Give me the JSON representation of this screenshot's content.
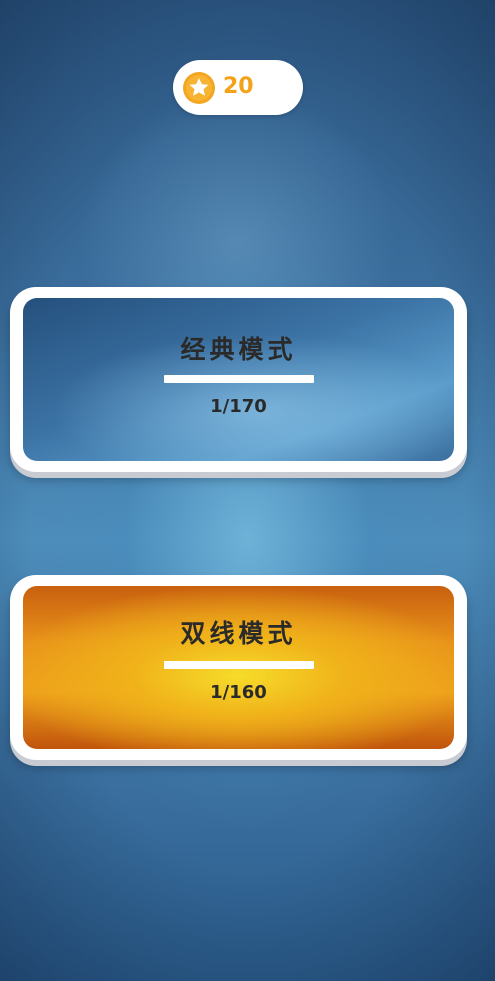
{
  "header": {
    "coin_icon": "star-coin-icon",
    "coins": "20",
    "coin_color": "#f2a31a"
  },
  "modes": [
    {
      "title": "经典模式",
      "progress": "1/170",
      "theme": "blue",
      "accent": "#3c74a6"
    },
    {
      "title": "双线模式",
      "progress": "1/160",
      "theme": "orange",
      "accent": "#ee9f1c"
    }
  ]
}
